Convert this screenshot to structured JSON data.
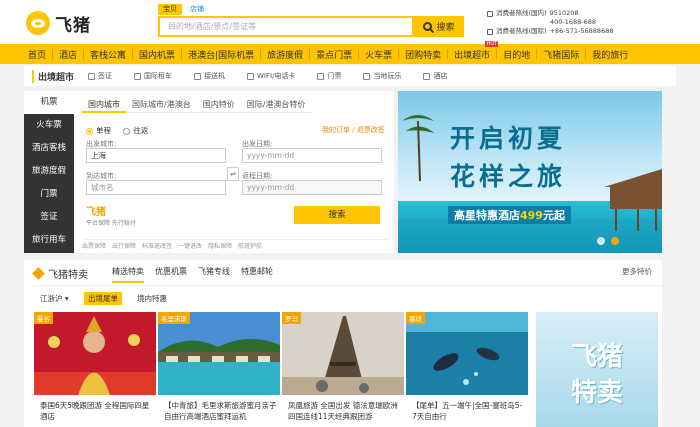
{
  "brand": {
    "name": "飞猪"
  },
  "search": {
    "tabs": [
      "宝贝",
      "店铺"
    ],
    "placeholder": "目的地/酒店/景点/签证等",
    "button": "搜索"
  },
  "hotline": {
    "rows": [
      [
        "消费者热线(国内)",
        "9510208"
      ],
      [
        "",
        "400-1688-688"
      ],
      [
        "消费者热线(国际)",
        "+86-571-56888688"
      ]
    ]
  },
  "nav": {
    "items": [
      "首页",
      "酒店",
      "客栈公寓",
      "国内机票",
      "港澳台|国际机票",
      "旅游度假",
      "景点门票",
      "火车票",
      "团购特卖",
      "出境超市",
      "目的地",
      "飞猪国际",
      "我的旅行"
    ],
    "hot_badge": "HOT"
  },
  "subnav": {
    "lead": "出境超市",
    "items": [
      "签证",
      "国际租车",
      "接送机",
      "WIFI/电话卡",
      "门票",
      "当地玩乐",
      "酒店"
    ]
  },
  "booking": {
    "side": [
      "机票",
      "火车票",
      "酒店客栈",
      "旅游度假",
      "门票",
      "签证",
      "旅行用车"
    ],
    "tabs": [
      "国内城市",
      "国际城市/港澳台",
      "国内特价",
      "国际/港澳台特价"
    ],
    "radios": [
      "单程",
      "往返"
    ],
    "links": "我的订单 / 退票改签",
    "from_label": "出发城市:",
    "from_value": "上海",
    "date_label": "出发日期:",
    "date_placeholder": "yyyy-mm-dd",
    "to_label": "到达城市:",
    "to_placeholder": "城市名",
    "ret_label": "返程日期:",
    "ret_placeholder": "yyyy-mm-dd",
    "logo_text": "飞猪",
    "logo_sub": "平台保障 先行赔付",
    "search": "搜索",
    "guarantees": [
      "出票保障",
      "出行保障",
      "标准退改签",
      "一键退改",
      "隐私保障",
      "航班护航"
    ]
  },
  "banner": {
    "line1": "开启初夏",
    "line2": "花样之旅",
    "sub_pre": "高星特惠酒店",
    "price": "499",
    "sub_post": "元起"
  },
  "featured": {
    "title": "飞猪特卖",
    "tabs": [
      "精选特卖",
      "优惠机票",
      "飞猪专线",
      "特惠邮轮"
    ],
    "more": "更多特价",
    "filter": "江浙沪",
    "subtabs": [
      "出境尾单",
      "境内特惠"
    ],
    "cards": [
      {
        "tag": "曼谷",
        "text": "泰国6天5晚跟团游 全程国际四星酒店"
      },
      {
        "tag": "毛里求斯",
        "text": "【中青旅】毛里求斯旅游蜜月亲子自由行高端酒店蜜拜运机"
      },
      {
        "tag": "罗马",
        "text": "凤凰旅游 全国出发 德法意瑞欧洲四国连线11天经典跟团游"
      },
      {
        "tag": "塞班",
        "text": "【尾单】五一端午|全国-塞班岛5-7天自由行"
      }
    ],
    "promo": {
      "line1": "飞猪",
      "line2": "特卖"
    }
  }
}
